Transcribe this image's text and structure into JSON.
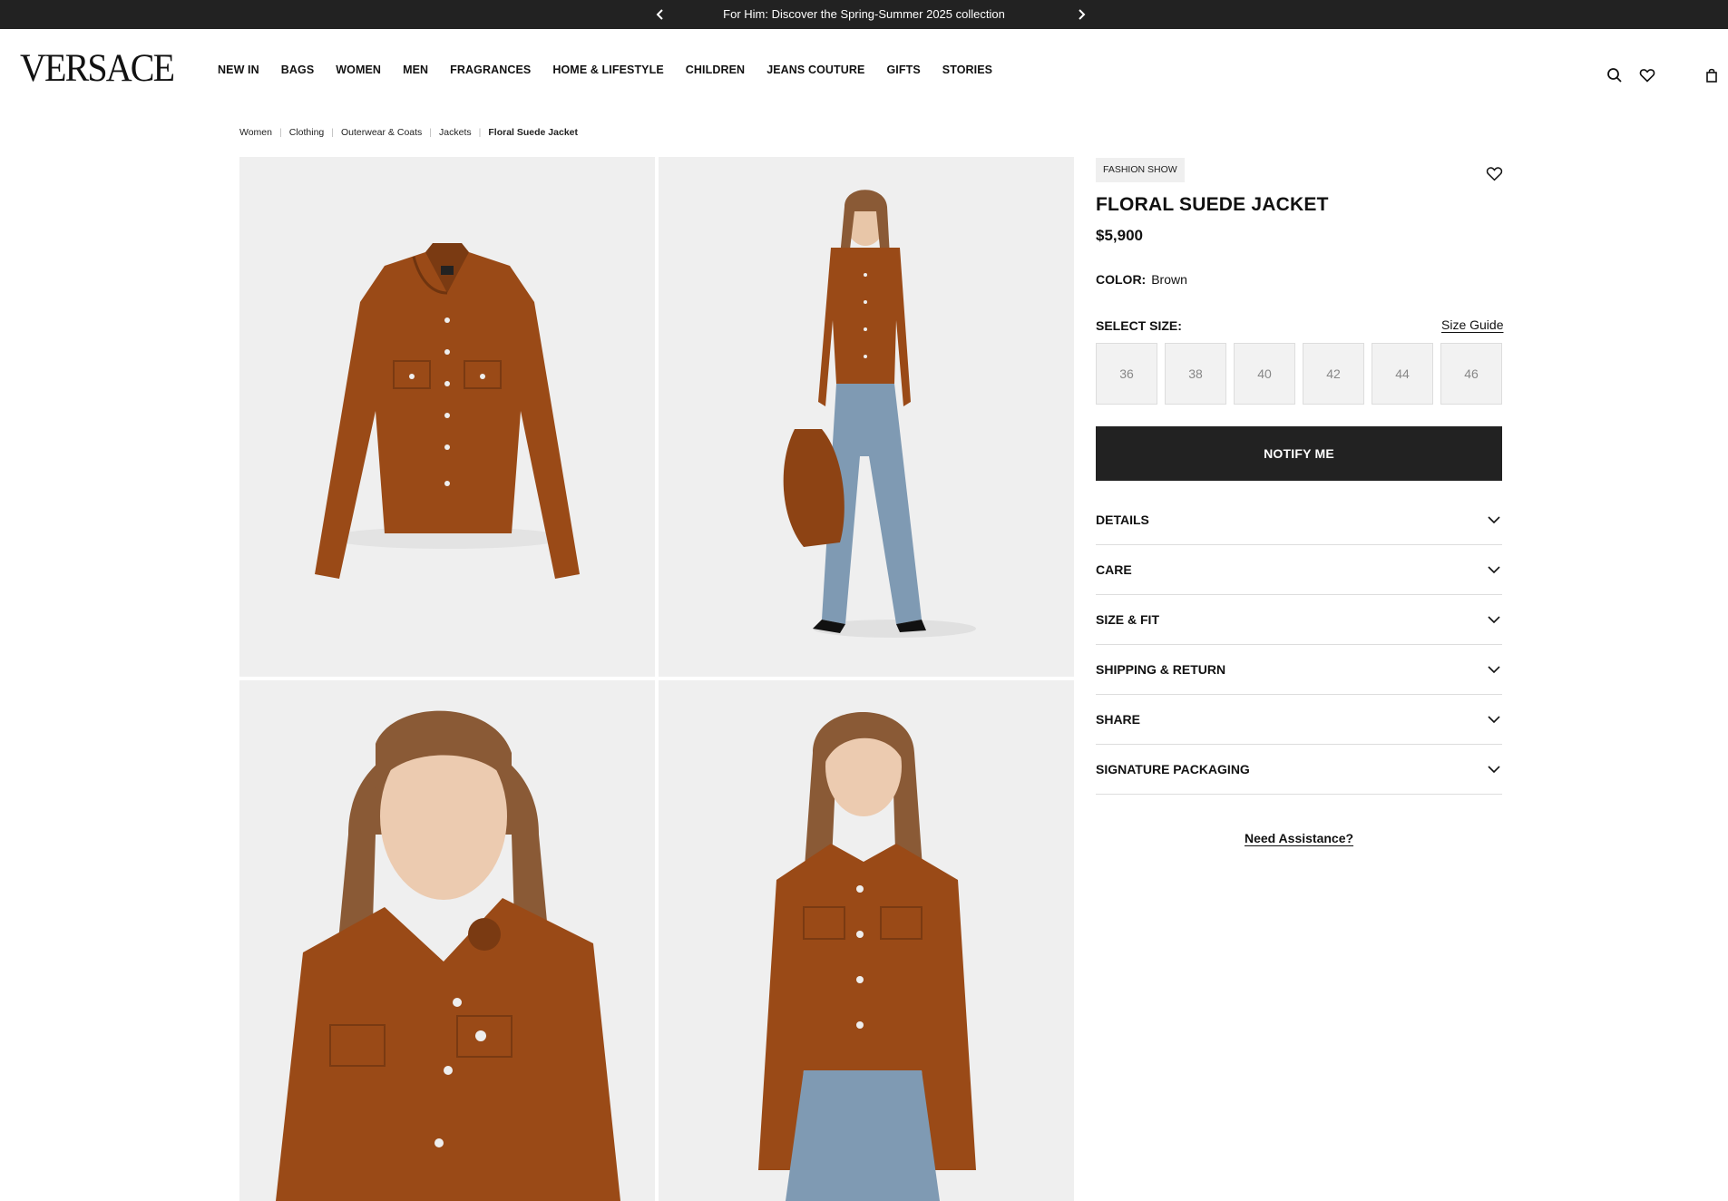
{
  "announcement": {
    "text": "For Him: Discover the Spring-Summer 2025 collection",
    "prev_icon": "chevron-left-icon",
    "next_icon": "chevron-right-icon"
  },
  "header": {
    "logo": "VERSACE",
    "nav": [
      "NEW IN",
      "BAGS",
      "WOMEN",
      "MEN",
      "FRAGRANCES",
      "HOME & LIFESTYLE",
      "CHILDREN",
      "JEANS COUTURE",
      "GIFTS",
      "STORIES"
    ],
    "icons": [
      "search-icon",
      "heart-icon",
      "shopping-bag-icon"
    ]
  },
  "breadcrumb": {
    "items": [
      "Women",
      "Clothing",
      "Outerwear & Coats",
      "Jackets"
    ],
    "current": "Floral Suede Jacket"
  },
  "gallery": {
    "images": [
      "jacket-flat-lay",
      "model-full-body",
      "model-close-up",
      "model-half-body"
    ]
  },
  "product": {
    "badge": "FASHION SHOW",
    "name": "FLORAL SUEDE JACKET",
    "price": "$5,900",
    "color_label": "COLOR:",
    "color_value": "Brown",
    "size_label": "SELECT SIZE:",
    "size_guide": "Size Guide",
    "sizes": [
      "36",
      "38",
      "40",
      "42",
      "44",
      "46"
    ],
    "cta": "NOTIFY ME",
    "accordion": [
      "DETAILS",
      "CARE",
      "SIZE & FIT",
      "SHIPPING & RETURN",
      "SHARE",
      "SIGNATURE PACKAGING"
    ],
    "assistance": "Need Assistance?"
  },
  "colors": {
    "suede": "#9a4a17",
    "denim": "#7f9ab3",
    "dark_bar": "#222222",
    "image_bg": "#efefef"
  }
}
